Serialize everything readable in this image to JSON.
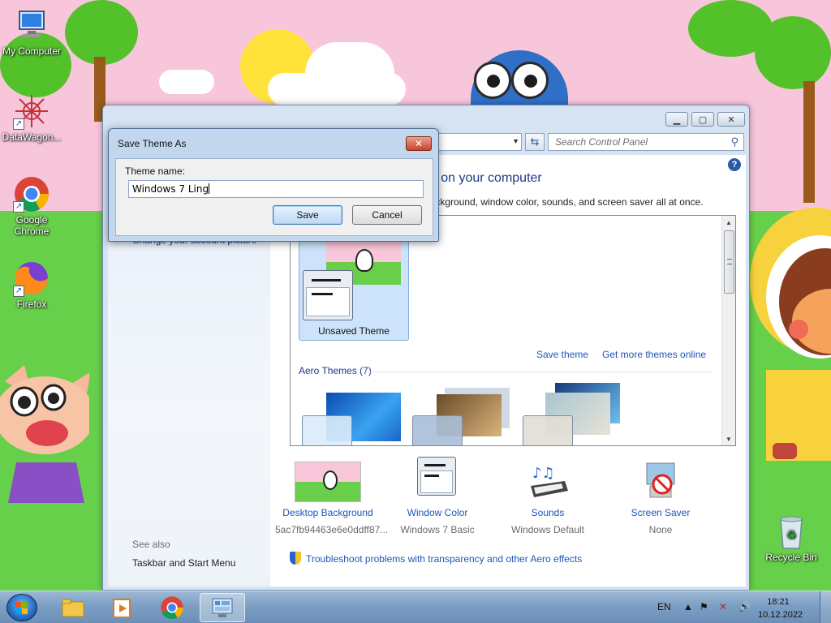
{
  "desktop": {
    "icons": [
      {
        "label": "My Computer"
      },
      {
        "label": "DataWagon..."
      },
      {
        "label": "Google Chrome"
      },
      {
        "label": "Firefox"
      },
      {
        "label": "Recycle Bin"
      }
    ]
  },
  "control_panel": {
    "search_placeholder": "Search Control Panel",
    "left_pane": {
      "link_account_picture": "Change your account picture",
      "see_also_label": "See also",
      "taskbar_link": "Taskbar and Start Menu"
    },
    "main": {
      "heading": "nds on your computer",
      "subheading": "p background, window color, sounds, and screen saver all at once.",
      "my_theme": {
        "label": "Unsaved Theme"
      },
      "save_theme_link": "Save theme",
      "get_more_link": "Get more themes online",
      "aero_group_title": "Aero Themes (7)",
      "bottom_items": [
        {
          "label": "Desktop Background",
          "value": "5ac7fb94463e6e0ddff87..."
        },
        {
          "label": "Window Color",
          "value": "Windows 7 Basic"
        },
        {
          "label": "Sounds",
          "value": "Windows Default"
        },
        {
          "label": "Screen Saver",
          "value": "None"
        }
      ],
      "troubleshoot_link": "Troubleshoot problems with transparency and other Aero effects"
    }
  },
  "save_dialog": {
    "title": "Save Theme As",
    "field_label": "Theme name:",
    "field_value": "Windows 7 Ling",
    "save_label": "Save",
    "cancel_label": "Cancel"
  },
  "taskbar": {
    "language": "EN",
    "time": "18:21",
    "date": "10.12.2022"
  }
}
